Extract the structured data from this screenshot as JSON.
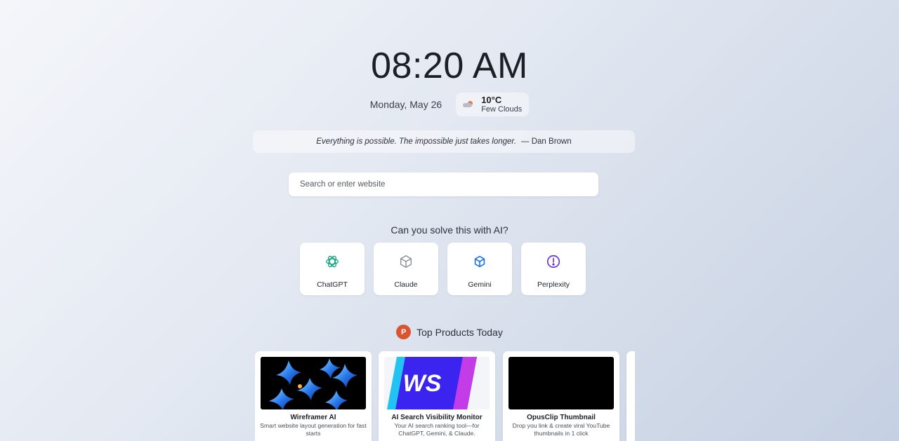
{
  "clock": {
    "time": "08:20 AM"
  },
  "date": "Monday, May 26",
  "weather": {
    "temp": "10°C",
    "condition": "Few Clouds",
    "icon": "partly-cloudy-icon"
  },
  "quote": {
    "text": "Everything is possible. The impossible just takes longer.",
    "author": "— Dan Brown"
  },
  "search": {
    "placeholder": "Search or enter website",
    "value": ""
  },
  "ai_section": {
    "heading": "Can you solve this with AI?",
    "tools": [
      {
        "label": "ChatGPT",
        "icon": "chatgpt-icon",
        "color": "#10a37f"
      },
      {
        "label": "Claude",
        "icon": "cube-icon",
        "color": "#8a8e96"
      },
      {
        "label": "Gemini",
        "icon": "cube-icon",
        "color": "#1a73e8"
      },
      {
        "label": "Perplexity",
        "icon": "alert-circle-icon",
        "color": "#6b2fd6"
      }
    ]
  },
  "products_section": {
    "heading": "Top Products Today",
    "logo_letter": "P",
    "logo_color": "#da552f",
    "items": [
      {
        "name": "Wireframer AI",
        "description": "Smart website layout generation for fast starts"
      },
      {
        "name": "AI Search Visibility Monitor",
        "description": "Your AI search ranking tool—for ChatGPT, Gemini, & Claude.",
        "image_text": "WS"
      },
      {
        "name": "OpusClip Thumbnail",
        "description": "Drop you link & create viral YouTube thumbnails in 1 click"
      }
    ]
  }
}
